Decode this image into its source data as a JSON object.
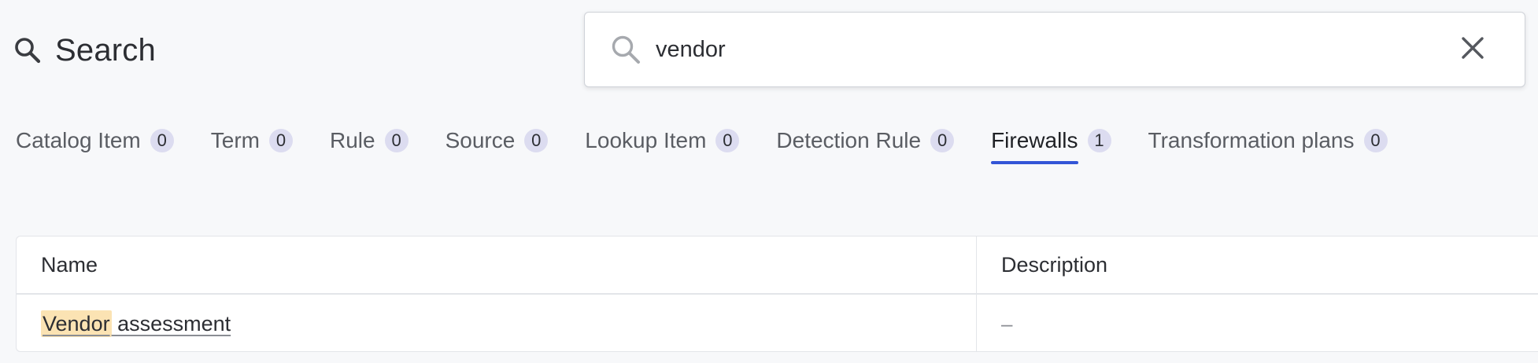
{
  "header": {
    "title": "Search",
    "title_icon": "search-icon"
  },
  "search": {
    "value": "vendor",
    "placeholder": "",
    "icon": "search-icon",
    "clear_icon": "close-icon"
  },
  "tabs": [
    {
      "label": "Catalog Item",
      "count": "0",
      "active": false
    },
    {
      "label": "Term",
      "count": "0",
      "active": false
    },
    {
      "label": "Rule",
      "count": "0",
      "active": false
    },
    {
      "label": "Source",
      "count": "0",
      "active": false
    },
    {
      "label": "Lookup Item",
      "count": "0",
      "active": false
    },
    {
      "label": "Detection Rule",
      "count": "0",
      "active": false
    },
    {
      "label": "Firewalls",
      "count": "1",
      "active": true
    },
    {
      "label": "Transformation plans",
      "count": "0",
      "active": false
    }
  ],
  "table": {
    "columns": [
      "Name",
      "Description"
    ],
    "rows": [
      {
        "name_match": "Vendor",
        "name_rest": " assessment",
        "description": "–"
      }
    ]
  },
  "colors": {
    "accent": "#3355d6",
    "badge_bg": "#dcdcf0",
    "highlight": "#fbe3b3",
    "background": "#f7f8fa"
  }
}
